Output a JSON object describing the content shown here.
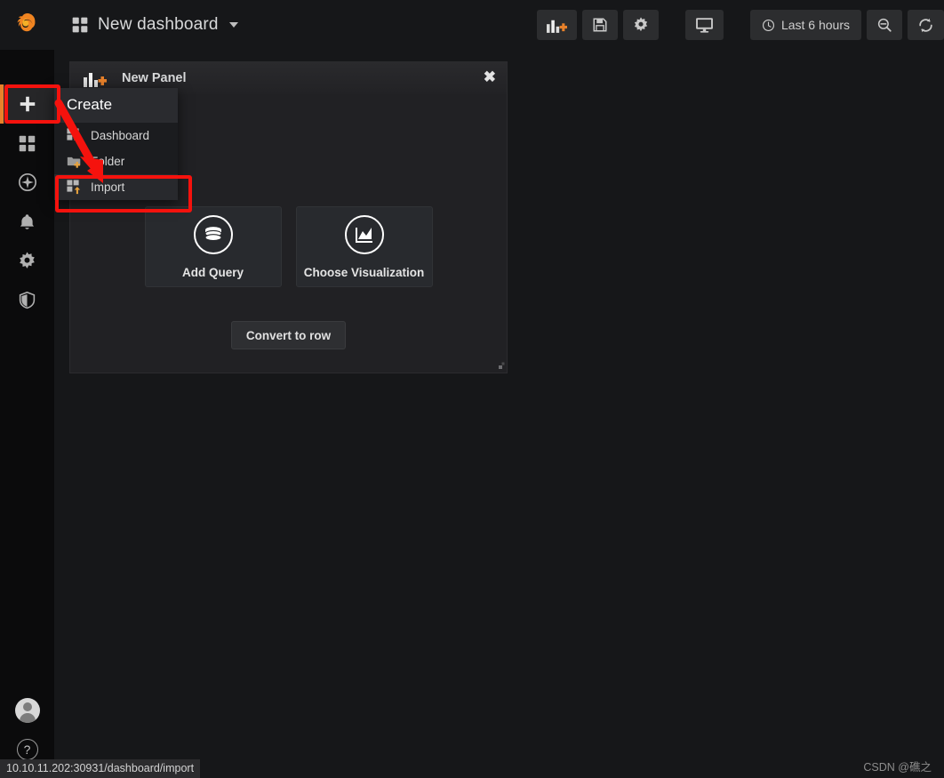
{
  "window": {
    "background_color": "#161719",
    "status_url": "10.10.11.202:30931/dashboard/import",
    "watermark": "CSDN @礁之"
  },
  "sidebar": {
    "logo": "grafana-logo",
    "items": [
      {
        "icon": "plus-icon",
        "label": "Create",
        "active": true
      },
      {
        "icon": "dashboards-icon",
        "label": "Dashboards",
        "active": false
      },
      {
        "icon": "compass-icon",
        "label": "Explore",
        "active": false
      },
      {
        "icon": "bell-icon",
        "label": "Alerting",
        "active": false
      },
      {
        "icon": "gear-icon",
        "label": "Configuration",
        "active": false
      },
      {
        "icon": "shield-icon",
        "label": "Server Admin",
        "active": false
      }
    ],
    "bottom": [
      {
        "icon": "avatar-icon",
        "label": "User"
      },
      {
        "icon": "question-icon",
        "label": "Help"
      }
    ]
  },
  "topbar": {
    "dashboard_icon": "dashboard-grid-icon",
    "title": "New dashboard",
    "caret": "chevron-down-icon",
    "actions": [
      {
        "name": "add-panel-button",
        "icon": "add-panel-icon"
      },
      {
        "name": "save-dashboard-button",
        "icon": "save-icon"
      },
      {
        "name": "dashboard-settings-button",
        "icon": "gear-icon"
      },
      {
        "name": "tv-mode-button",
        "icon": "monitor-icon"
      }
    ],
    "time_picker": {
      "icon": "clock-icon",
      "label": "Last 6 hours"
    },
    "zoom_out": {
      "name": "zoom-out-button",
      "icon": "magnifier-minus-icon"
    },
    "refresh": {
      "name": "refresh-button",
      "icon": "refresh-icon"
    }
  },
  "create_menu": {
    "title": "Create",
    "items": [
      {
        "label": "Dashboard",
        "icon": "dashboard-plus-icon",
        "hover": false
      },
      {
        "label": "Folder",
        "icon": "folder-plus-icon",
        "hover": false
      },
      {
        "label": "Import",
        "icon": "import-icon",
        "hover": true
      }
    ]
  },
  "panel": {
    "icon": "add-panel-icon",
    "title": "New Panel",
    "close_label": "✖",
    "cards": [
      {
        "label": "Add Query",
        "icon": "database-icon"
      },
      {
        "label": "Choose Visualization",
        "icon": "graph-icon"
      }
    ],
    "convert_button": "Convert to row",
    "resize_handle": "resize-handle-icon"
  },
  "annotations": {
    "accent_color": "#f5120d",
    "highlight_plus": "create-button-highlight",
    "highlight_import": "import-menu-highlight",
    "arrow": "red-arrow-pointing-to-import"
  }
}
